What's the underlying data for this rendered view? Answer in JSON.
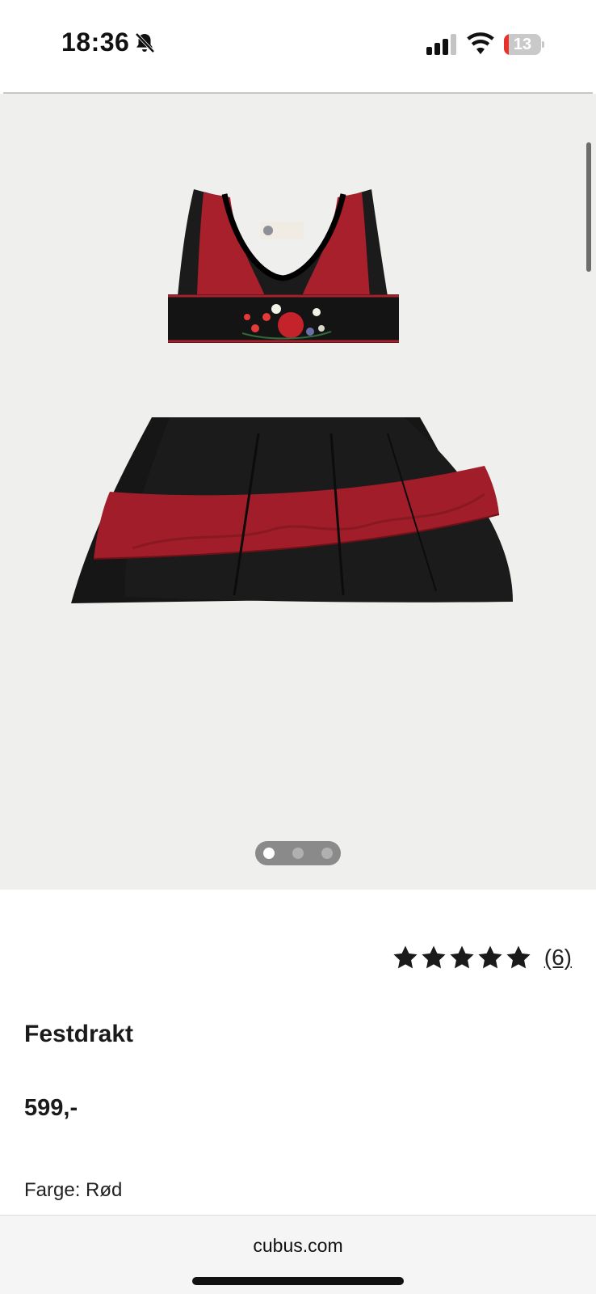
{
  "status_bar": {
    "time": "18:36",
    "battery_level": "13",
    "battery_fraction": 0.13,
    "icons": [
      "bell-slash-icon",
      "signal-icon",
      "wifi-icon",
      "battery-icon"
    ]
  },
  "gallery": {
    "image": "red-black-bunad-dress-image",
    "page_count": 3,
    "current_page": 1
  },
  "product": {
    "rating_stars": 5,
    "rating_count": "(6)",
    "title": "Festdrakt",
    "price": "599,-",
    "color_label": "Farge: Rød"
  },
  "browser": {
    "url": "cubus.com"
  },
  "colors": {
    "dress_black": "#1a1a1a",
    "dress_red": "#a8202c",
    "gallery_bg": "#efefed",
    "battery_red": "#e5322b"
  }
}
